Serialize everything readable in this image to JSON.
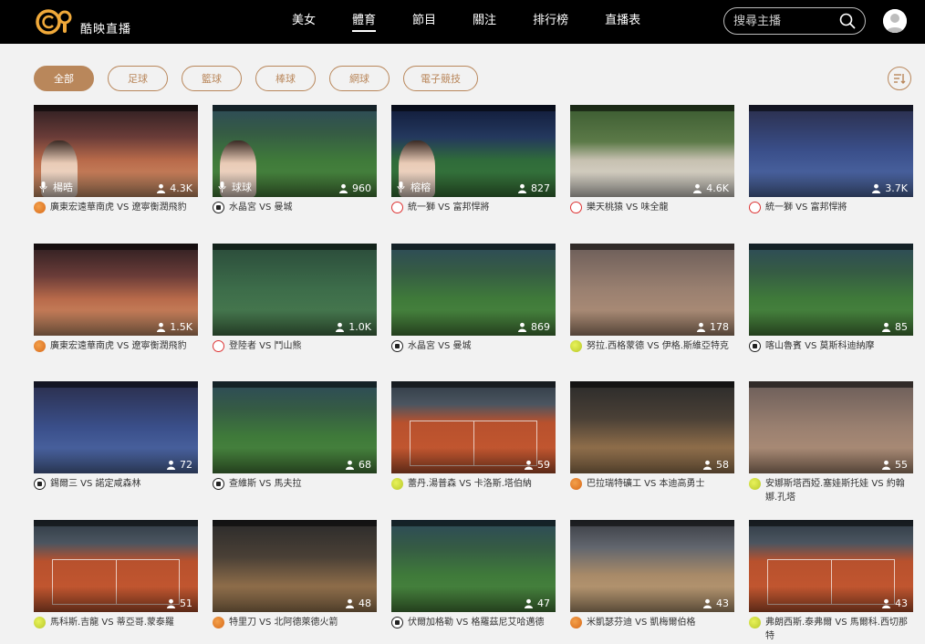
{
  "app": {
    "logo_text": "酷映直播"
  },
  "nav": {
    "items": [
      {
        "label": "美女",
        "active": false
      },
      {
        "label": "體育",
        "active": true
      },
      {
        "label": "節目",
        "active": false
      },
      {
        "label": "關注",
        "active": false
      },
      {
        "label": "排行榜",
        "active": false
      },
      {
        "label": "直播表",
        "active": false
      }
    ]
  },
  "search": {
    "placeholder": "搜尋主播"
  },
  "filters": {
    "items": [
      {
        "label": "全部",
        "active": true
      },
      {
        "label": "足球",
        "active": false
      },
      {
        "label": "籃球",
        "active": false
      },
      {
        "label": "棒球",
        "active": false
      },
      {
        "label": "網球",
        "active": false
      },
      {
        "label": "電子競技",
        "active": false
      }
    ]
  },
  "colors": {
    "accent": "#b9875b",
    "header_bg": "#000000",
    "page_bg": "#f2f2f2"
  },
  "streams": [
    {
      "title": "廣東宏遠華南虎 VS 遼寧衡潤飛豹",
      "viewers": "4.3K",
      "host": "楊晧",
      "sport": "basketball",
      "scene": "bg-court-red"
    },
    {
      "title": "水晶宮 VS 曼城",
      "viewers": "960",
      "host": "球球",
      "sport": "football",
      "scene": "bg-pitch"
    },
    {
      "title": "統一獅 VS 富邦悍將",
      "viewers": "827",
      "host": "榕榕",
      "sport": "baseball",
      "scene": "bg-stadium-night"
    },
    {
      "title": "樂天桃猿 VS 味全龍",
      "viewers": "4.6K",
      "host": "",
      "sport": "baseball",
      "scene": "bg-baseball-white"
    },
    {
      "title": "統一獅 VS 富邦悍將",
      "viewers": "3.7K",
      "host": "",
      "sport": "baseball",
      "scene": "bg-stage-blue"
    },
    {
      "title": "廣東宏遠華南虎 VS 遼寧衡潤飛豹",
      "viewers": "1.5K",
      "host": "",
      "sport": "basketball",
      "scene": "bg-court-red"
    },
    {
      "title": "登陸者 VS 鬥山熊",
      "viewers": "1.0K",
      "host": "",
      "sport": "baseball",
      "scene": "bg-baseball-green"
    },
    {
      "title": "水晶宮 VS 曼城",
      "viewers": "869",
      "host": "",
      "sport": "football",
      "scene": "bg-pitch"
    },
    {
      "title": "努拉.西格蒙德 VS 伊格.斯維亞特克",
      "viewers": "178",
      "host": "",
      "sport": "tennis",
      "scene": "bg-tennis-player"
    },
    {
      "title": "喀山魯賓 VS 莫斯科迪納摩",
      "viewers": "85",
      "host": "",
      "sport": "football",
      "scene": "bg-pitch"
    },
    {
      "title": "錫爾三 VS 諾定咸森林",
      "viewers": "72",
      "host": "",
      "sport": "football",
      "scene": "bg-stage-blue"
    },
    {
      "title": "查維斯 VS 馬夫拉",
      "viewers": "68",
      "host": "",
      "sport": "football",
      "scene": "bg-pitch"
    },
    {
      "title": "蕾丹.湯普森 VS 卡洛斯.塔伯納",
      "viewers": "59",
      "host": "",
      "sport": "tennis",
      "scene": "bg-clay"
    },
    {
      "title": "巴拉瑞特礦工 VS 本迪高勇士",
      "viewers": "58",
      "host": "",
      "sport": "basketball",
      "scene": "bg-indoor"
    },
    {
      "title": "安娜斯塔西婭.塞娃斯托娃 VS 約翰娜.孔塔",
      "viewers": "55",
      "host": "",
      "sport": "tennis",
      "scene": "bg-tennis-player"
    },
    {
      "title": "馬科斯.吉龍 VS 蒂亞哥.蒙泰羅",
      "viewers": "51",
      "host": "",
      "sport": "tennis",
      "scene": "bg-clay"
    },
    {
      "title": "特里刀 VS 北阿德萊德火箭",
      "viewers": "48",
      "host": "",
      "sport": "basketball",
      "scene": "bg-indoor"
    },
    {
      "title": "伏爾加格勒 VS 格羅茲尼艾哈邁德",
      "viewers": "47",
      "host": "",
      "sport": "football",
      "scene": "bg-pitch"
    },
    {
      "title": "米凱瑟芬迪 VS 凱梅爾伯格",
      "viewers": "43",
      "host": "",
      "sport": "basketball",
      "scene": "bg-court-pale"
    },
    {
      "title": "弗朗西斯.泰弗爾 VS 馬爾科.西切那特",
      "viewers": "43",
      "host": "",
      "sport": "tennis",
      "scene": "bg-clay"
    }
  ]
}
